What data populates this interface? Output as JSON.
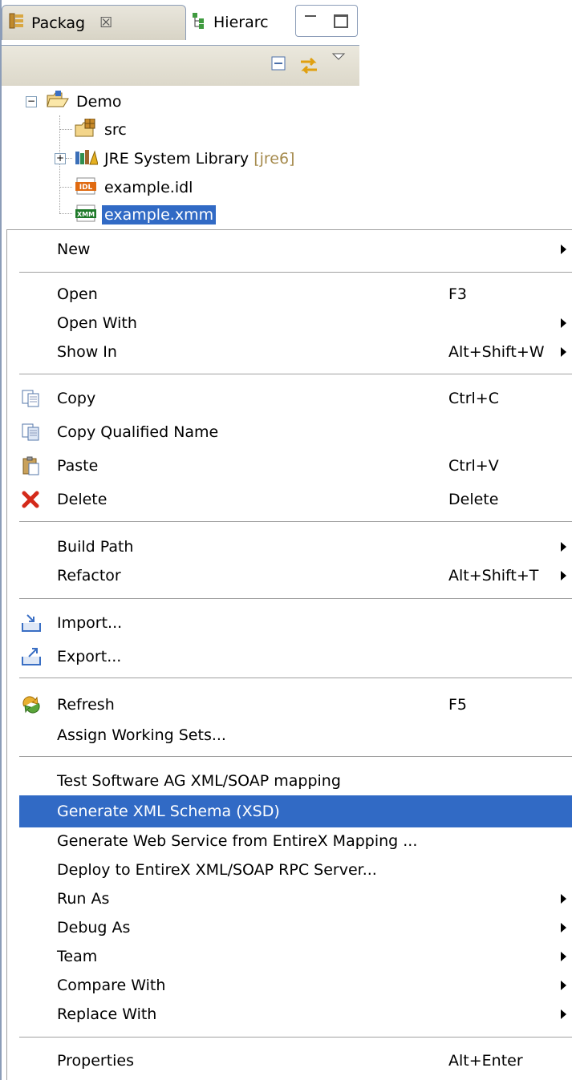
{
  "tabs": [
    {
      "label": "Packag",
      "close": "☒"
    },
    {
      "label": "Hierarc"
    }
  ],
  "tree": {
    "project": "Demo",
    "items": [
      {
        "label": "src"
      },
      {
        "label": "JRE System Library",
        "decoration": "[jre6]"
      },
      {
        "label": "example.idl"
      },
      {
        "label": "example.xmm"
      }
    ]
  },
  "menu": {
    "new": {
      "label": "New"
    },
    "open": {
      "label": "Open",
      "accel": "F3"
    },
    "open_with": {
      "label": "Open With"
    },
    "show_in": {
      "label": "Show In",
      "accel": "Alt+Shift+W"
    },
    "copy": {
      "label": "Copy",
      "accel": "Ctrl+C"
    },
    "copy_qualified": {
      "label": "Copy Qualified Name"
    },
    "paste": {
      "label": "Paste",
      "accel": "Ctrl+V"
    },
    "delete": {
      "label": "Delete",
      "accel": "Delete"
    },
    "build_path": {
      "label": "Build Path"
    },
    "refactor": {
      "label": "Refactor",
      "accel": "Alt+Shift+T"
    },
    "import": {
      "label": "Import..."
    },
    "export": {
      "label": "Export..."
    },
    "refresh": {
      "label": "Refresh",
      "accel": "F5"
    },
    "assign_ws": {
      "label": "Assign Working Sets..."
    },
    "test_sag": {
      "label": "Test Software AG XML/SOAP mapping"
    },
    "gen_xsd": {
      "label": "Generate XML Schema (XSD)"
    },
    "gen_ws": {
      "label": "Generate Web Service from EntireX Mapping ..."
    },
    "deploy": {
      "label": "Deploy to EntireX XML/SOAP RPC Server..."
    },
    "run_as": {
      "label": "Run As"
    },
    "debug_as": {
      "label": "Debug As"
    },
    "team": {
      "label": "Team"
    },
    "compare": {
      "label": "Compare With"
    },
    "replace": {
      "label": "Replace With"
    },
    "properties": {
      "label": "Properties",
      "accel": "Alt+Enter"
    }
  },
  "colors": {
    "selection": "#316ac5",
    "view_border": "#8c9db8",
    "decoration": "#a58a4c"
  }
}
